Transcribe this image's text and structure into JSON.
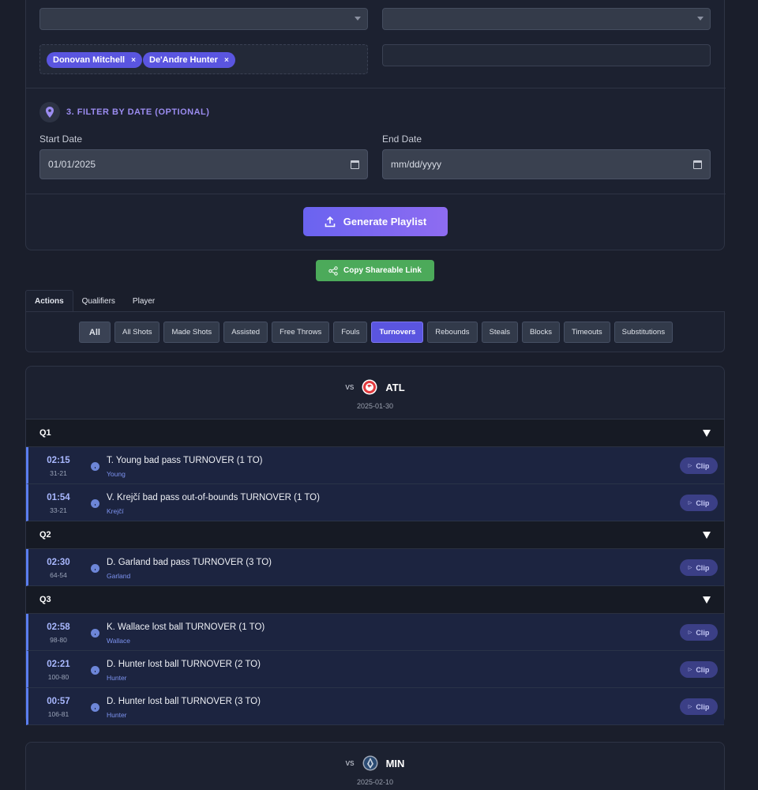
{
  "players_filter": {
    "tags": [
      {
        "label": "Donovan Mitchell",
        "remove": "×"
      },
      {
        "label": "De'Andre Hunter",
        "remove": "×"
      }
    ]
  },
  "date_filter": {
    "section_title": "3. FILTER BY DATE (OPTIONAL)",
    "start_label": "Start Date",
    "start_value": "01/01/2025",
    "end_label": "End Date",
    "end_value": "mm/dd/yyyy"
  },
  "actions": {
    "generate": "Generate Playlist",
    "share": "Copy Shareable Link"
  },
  "tabs": [
    "Actions",
    "Qualifiers",
    "Player"
  ],
  "chips": [
    "All",
    "All Shots",
    "Made Shots",
    "Assisted",
    "Free Throws",
    "Fouls",
    "Turnovers",
    "Rebounds",
    "Steals",
    "Blocks",
    "Timeouts",
    "Substitutions"
  ],
  "selected_chip": "Turnovers",
  "games": [
    {
      "vs": "vs",
      "team": "ATL",
      "date": "2025-01-30",
      "quarters": [
        {
          "label": "Q1",
          "plays": [
            {
              "time": "02:15",
              "score": "31-21",
              "desc": "T. Young bad pass TURNOVER (1 TO)",
              "player": "Young"
            },
            {
              "time": "01:54",
              "score": "33-21",
              "desc": "V. Krejčí bad pass out-of-bounds TURNOVER (1 TO)",
              "player": "Krejčí"
            }
          ]
        },
        {
          "label": "Q2",
          "plays": [
            {
              "time": "02:30",
              "score": "64-54",
              "desc": "D. Garland bad pass TURNOVER (3 TO)",
              "player": "Garland"
            }
          ]
        },
        {
          "label": "Q3",
          "plays": [
            {
              "time": "02:58",
              "score": "98-80",
              "desc": "K. Wallace lost ball TURNOVER (1 TO)",
              "player": "Wallace"
            },
            {
              "time": "02:21",
              "score": "100-80",
              "desc": "D. Hunter lost ball TURNOVER (2 TO)",
              "player": "Hunter"
            },
            {
              "time": "00:57",
              "score": "106-81",
              "desc": "D. Hunter lost ball TURNOVER (3 TO)",
              "player": "Hunter"
            }
          ]
        }
      ]
    },
    {
      "vs": "vs",
      "team": "MIN",
      "date": "2025-02-10"
    }
  ],
  "clip_label": "Clip",
  "colors": {
    "accent": "#5a55e0",
    "share": "#4caa5a",
    "play_border": "#5b7ef0"
  }
}
